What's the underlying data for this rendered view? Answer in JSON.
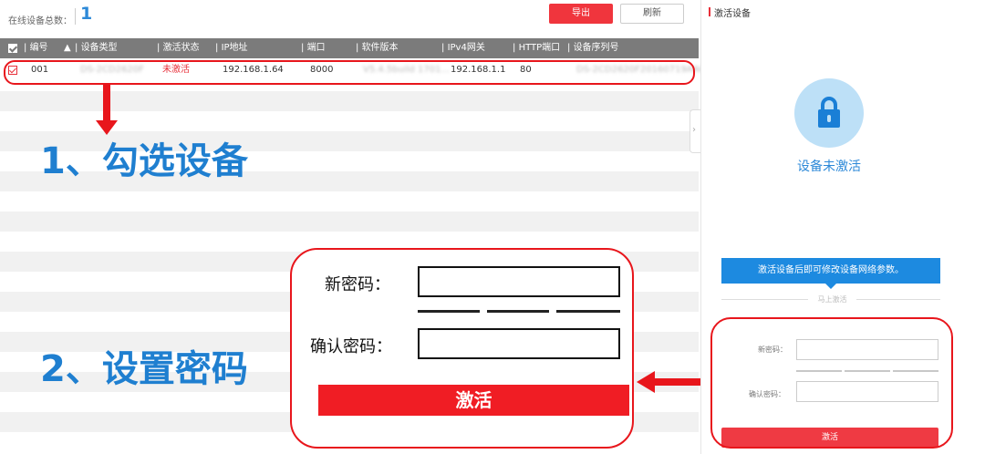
{
  "topbar": {
    "online_count_label": "在线设备总数：",
    "online_count_value": "1",
    "export_label": "导出",
    "refresh_label": "刷新"
  },
  "table": {
    "columns": [
      "编号",
      "设备类型",
      "激活状态",
      "IP地址",
      "端口",
      "软件版本",
      "IPv4网关",
      "HTTP端口",
      "设备序列号"
    ],
    "row": {
      "index": "001",
      "device_type": "DS-2CD2620F",
      "status": "未激活",
      "ip": "192.168.1.64",
      "port": "8000",
      "software_version": "V5.4.5build 1701...",
      "gateway": "192.168.1.1",
      "http_port": "80",
      "serial": "DS-2CD2620F20160719AACH"
    }
  },
  "annotations": {
    "step1": "1、勾选设备",
    "step2": "2、设置密码"
  },
  "zoom": {
    "new_password_label": "新密码：",
    "confirm_password_label": "确认密码：",
    "activate_label": "激活"
  },
  "side": {
    "title": "激活设备",
    "status": "设备未激活",
    "info": "激活设备后即可修改设备网络参数。",
    "divider": "马上激活",
    "new_password_label": "新密码：",
    "confirm_password_label": "确认密码：",
    "activate_label": "激活"
  },
  "colors": {
    "accent_red": "#e8161c",
    "accent_blue": "#1f7fd0"
  }
}
